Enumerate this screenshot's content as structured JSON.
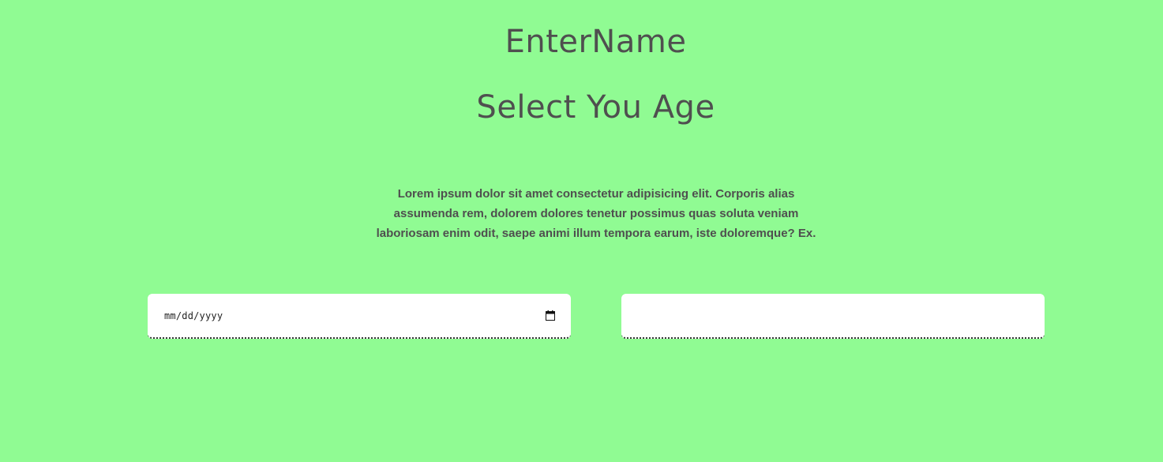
{
  "header": {
    "title": "EnterName",
    "subtitle": "Select You Age"
  },
  "intro": {
    "text": "Lorem ipsum dolor sit amet consectetur adipisicing elit. Corporis alias assumenda rem, dolorem dolores tenetur possimus quas soluta veniam laboriosam enim odit, saepe animi illum tempora earum, iste doloremque? Ex."
  },
  "form": {
    "date_field": {
      "placeholder": "mm/dd/yyyy",
      "icon": "calendar-icon"
    },
    "second_field": {
      "value": "",
      "placeholder": ""
    }
  },
  "colors": {
    "background": "#90fb93",
    "text": "#4f4f4f",
    "field_background": "#ffffff"
  }
}
